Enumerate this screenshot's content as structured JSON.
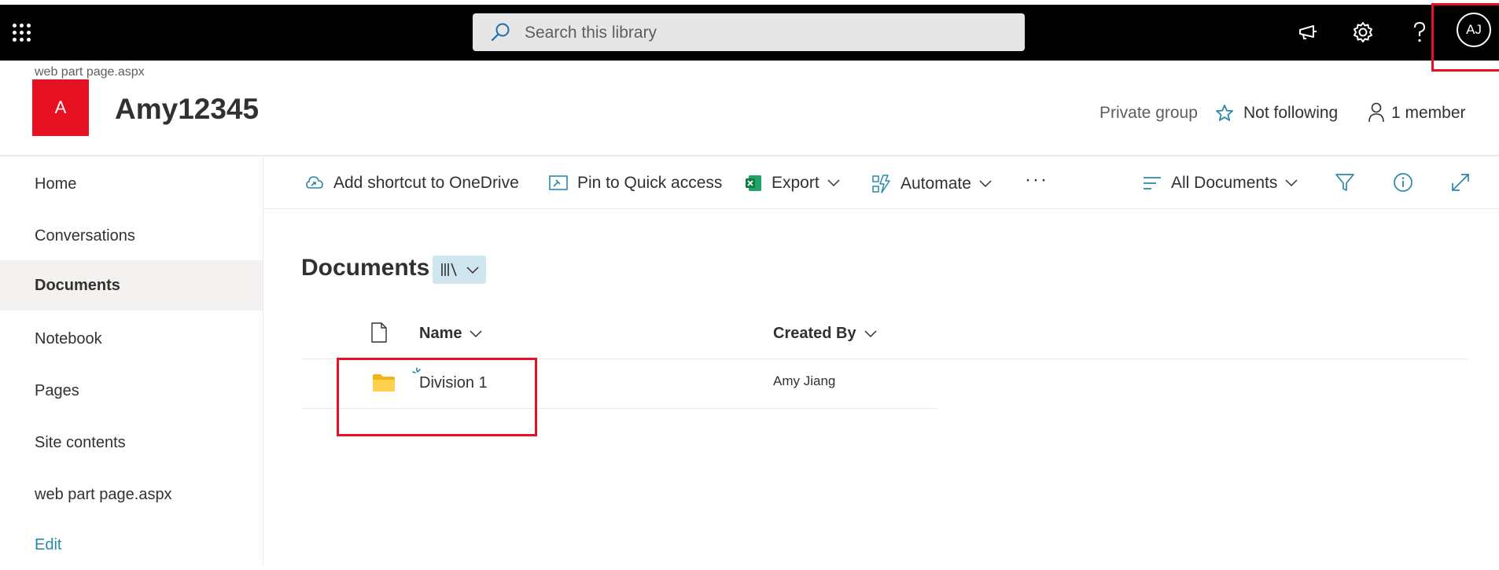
{
  "topbar": {
    "search_placeholder": "Search this library",
    "avatar_initials": "AJ"
  },
  "site": {
    "breadcrumb": "web part page.aspx",
    "logo_letter": "A",
    "title": "Amy12345",
    "privacy": "Private group",
    "follow": "Not following",
    "members": "1 member"
  },
  "nav": {
    "items": [
      {
        "label": "Home"
      },
      {
        "label": "Conversations"
      },
      {
        "label": "Documents"
      },
      {
        "label": "Notebook"
      },
      {
        "label": "Pages"
      },
      {
        "label": "Site contents"
      },
      {
        "label": "web part page.aspx"
      }
    ],
    "edit": "Edit"
  },
  "commands": {
    "add_shortcut": "Add shortcut to OneDrive",
    "pin": "Pin to Quick access",
    "export": "Export",
    "automate": "Automate",
    "more": "···",
    "view": "All Documents"
  },
  "library": {
    "title": "Documents",
    "columns": {
      "name": "Name",
      "created_by": "Created By"
    },
    "rows": [
      {
        "name": "Division 1",
        "created_by": "Amy Jiang"
      }
    ]
  },
  "colors": {
    "accent": "#e81123",
    "topbar": "#000000",
    "teal": "#2b88a8"
  }
}
